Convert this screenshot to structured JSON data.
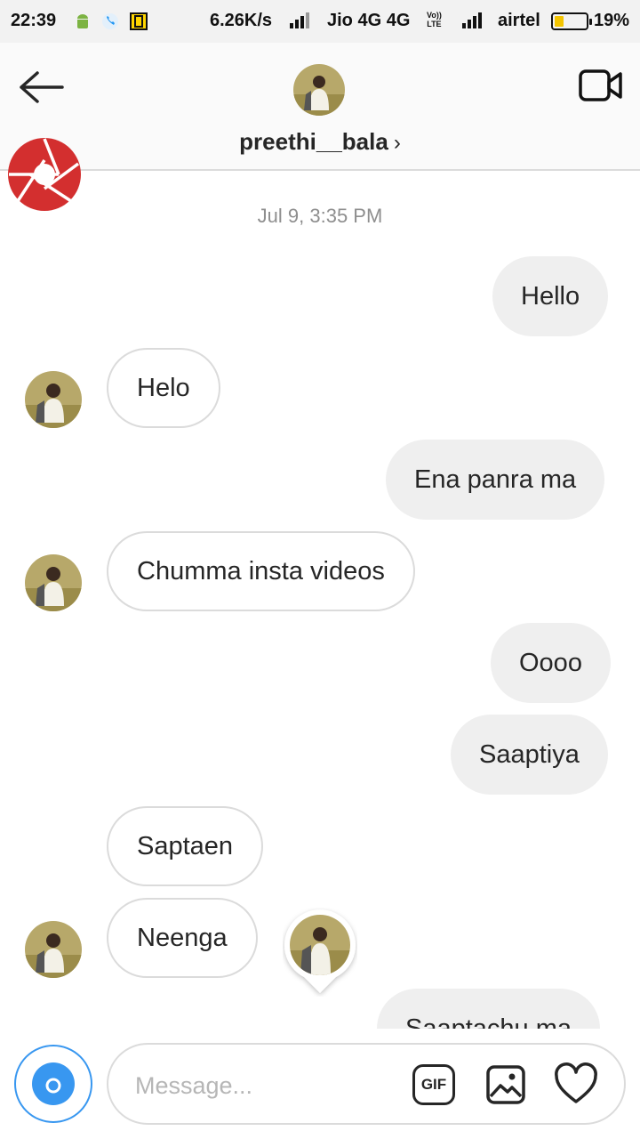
{
  "status_bar": {
    "time": "22:39",
    "speed": "6.26K/s",
    "carrier1": "Jio 4G 4G",
    "volte_line1": "Vo))",
    "volte_line2": "LTE",
    "carrier2": "airtel",
    "battery_pct": "19%",
    "battery_level": 0.19,
    "icons": [
      "android-icon",
      "phone-call-icon",
      "vibrate-icon"
    ]
  },
  "header": {
    "username": "preethi__bala",
    "chevron": "›"
  },
  "conversation": {
    "timestamp": "Jul 9, 3:35 PM",
    "messages": [
      {
        "direction": "sent",
        "text": "Hello"
      },
      {
        "direction": "received",
        "text": "Helo"
      },
      {
        "direction": "sent",
        "text": "Ena panra ma"
      },
      {
        "direction": "received",
        "text": "Chumma insta videos"
      },
      {
        "direction": "sent",
        "text": "Oooo"
      },
      {
        "direction": "sent",
        "text": "Saaptiya"
      },
      {
        "direction": "received",
        "text": "Saptaen"
      },
      {
        "direction": "received",
        "text": "Neenga"
      },
      {
        "direction": "sent",
        "text": "Saaptachu ma"
      }
    ]
  },
  "composer": {
    "placeholder": "Message...",
    "gif_label": "GIF"
  },
  "colors": {
    "accent": "#3897f0",
    "sent_bubble": "#efefef",
    "border": "#dbdbdb",
    "logo": "#d32f2f"
  }
}
